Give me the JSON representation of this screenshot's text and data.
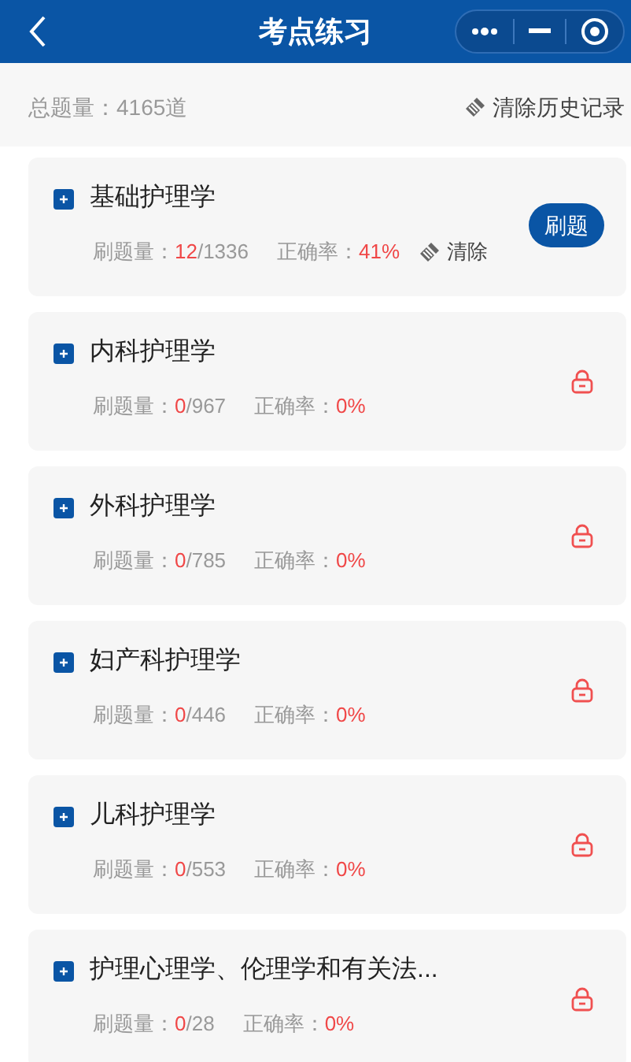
{
  "header": {
    "title": "考点练习"
  },
  "summary": {
    "total": "总题量：4165道",
    "clear_history": "清除历史记录"
  },
  "subjects": [
    {
      "name": "基础护理学",
      "done_label": "刷题量：",
      "done": "12",
      "total": "/1336",
      "rate_label": "正确率：",
      "rate": "41%",
      "locked": false,
      "clear": "清除",
      "action": "刷题"
    },
    {
      "name": "内科护理学",
      "done_label": "刷题量：",
      "done": "0",
      "total": "/967",
      "rate_label": "正确率：",
      "rate": "0%",
      "locked": true
    },
    {
      "name": "外科护理学",
      "done_label": "刷题量：",
      "done": "0",
      "total": "/785",
      "rate_label": "正确率：",
      "rate": "0%",
      "locked": true
    },
    {
      "name": "妇产科护理学",
      "done_label": "刷题量：",
      "done": "0",
      "total": "/446",
      "rate_label": "正确率：",
      "rate": "0%",
      "locked": true
    },
    {
      "name": "儿科护理学",
      "done_label": "刷题量：",
      "done": "0",
      "total": "/553",
      "rate_label": "正确率：",
      "rate": "0%",
      "locked": true
    },
    {
      "name": "护理心理学、伦理学和有关法...",
      "done_label": "刷题量：",
      "done": "0",
      "total": "/28",
      "rate_label": "正确率：",
      "rate": "0%",
      "locked": true
    }
  ]
}
